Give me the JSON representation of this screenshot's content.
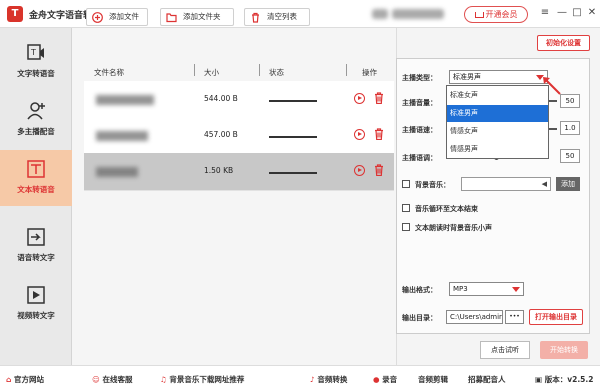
{
  "app": {
    "title": "金舟文字语音转换软件",
    "logo_char": "T",
    "vip_label": "开通会员"
  },
  "window": {
    "menu_icon": "≡",
    "minimize_icon": "—",
    "maximize_icon": "□",
    "close_icon": "✕"
  },
  "sidebar": {
    "items": [
      {
        "label": "文字转语音",
        "icon": "text-to-speech-icon"
      },
      {
        "label": "多主播配音",
        "icon": "user-add-icon"
      },
      {
        "label": "文本转语音",
        "icon": "text-doc-icon"
      },
      {
        "label": "语音转文字",
        "icon": "speech-to-text-icon"
      },
      {
        "label": "视频转文字",
        "icon": "video-to-text-icon"
      }
    ],
    "active_index": 2
  },
  "toolbar": {
    "add_file": "添加文件",
    "add_folder": "添加文件夹",
    "clear_list": "清空列表"
  },
  "table": {
    "headers": [
      "文件名称",
      "大小",
      "状态",
      "操作"
    ],
    "rows": [
      {
        "size": "544.00 B"
      },
      {
        "size": "457.00 B"
      },
      {
        "size": "1.50 KB"
      }
    ],
    "selected_row": 2
  },
  "settings": {
    "init_button": "初始化设置",
    "voice_type_label": "主播类型：",
    "voice_type_value": "标准男声",
    "voice_options": [
      "标准女声",
      "标准男声",
      "情感女声",
      "情感男声"
    ],
    "voice_option_highlight": 1,
    "volume_label": "主播音量：",
    "volume_value": "50",
    "speed_label": "主播语速：",
    "speed_value": "1.0",
    "pitch_label": "主播语调：",
    "pitch_value": "50",
    "bgm_label": "背景音乐：",
    "bgm_button": "添加",
    "loop_label": "音乐循环至文本结束",
    "duck_label": "文本朗读时背景音乐小声",
    "format_label": "输出格式：",
    "format_value": "MP3",
    "dir_label": "输出目录：",
    "dir_value": "C:\\Users\\admir",
    "dir_more": "•••",
    "open_dir_button": "打开输出目录",
    "trial_button": "点击试听",
    "convert_button": "开始转换"
  },
  "statusbar": {
    "website": "官方网站",
    "support": "在线客服",
    "bgm_download": "背景音乐下载网址推荐",
    "audio_convert": "音频转换",
    "record": "录音",
    "audio_edit": "音频剪辑",
    "dubbing": "招募配音人",
    "version": "版本：v2.5.2"
  },
  "colors": {
    "accent": "#d9342b",
    "active_nav": "#f6c9a7",
    "highlight": "#1e6fd6"
  }
}
